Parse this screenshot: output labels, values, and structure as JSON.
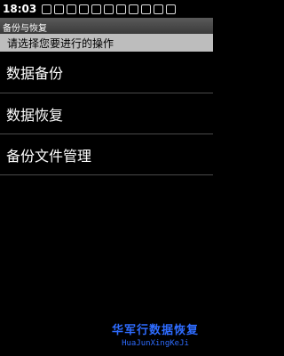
{
  "status_bar": {
    "time": "18:03"
  },
  "app_title": "备份与恢复",
  "prompt": "请选择您要进行的操作",
  "menu": [
    {
      "label": "数据备份"
    },
    {
      "label": "数据恢复"
    },
    {
      "label": "备份文件管理"
    }
  ],
  "watermark": {
    "cn": "华军行数据恢复",
    "en": "HuaJunXingKeJi"
  }
}
